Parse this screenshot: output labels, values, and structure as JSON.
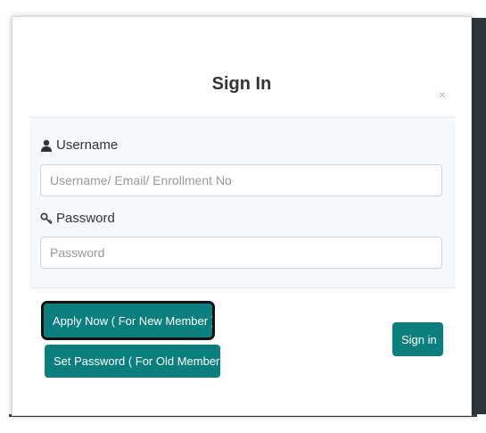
{
  "modal": {
    "title": "Sign In",
    "close_glyph": "×"
  },
  "form": {
    "username": {
      "label": "Username",
      "icon": "user-icon",
      "placeholder": "Username/ Email/ Enrollment No",
      "value": ""
    },
    "password": {
      "label": "Password",
      "icon": "key-icon",
      "placeholder": "Password",
      "value": ""
    }
  },
  "actions": {
    "apply_label": "Apply Now ( For New Member )",
    "set_password_label": "Set Password ( For Old Member )",
    "signin_label": "Sign in"
  },
  "colors": {
    "button_teal": "#0b7f7d",
    "panel_background": "#f6f9fc"
  }
}
